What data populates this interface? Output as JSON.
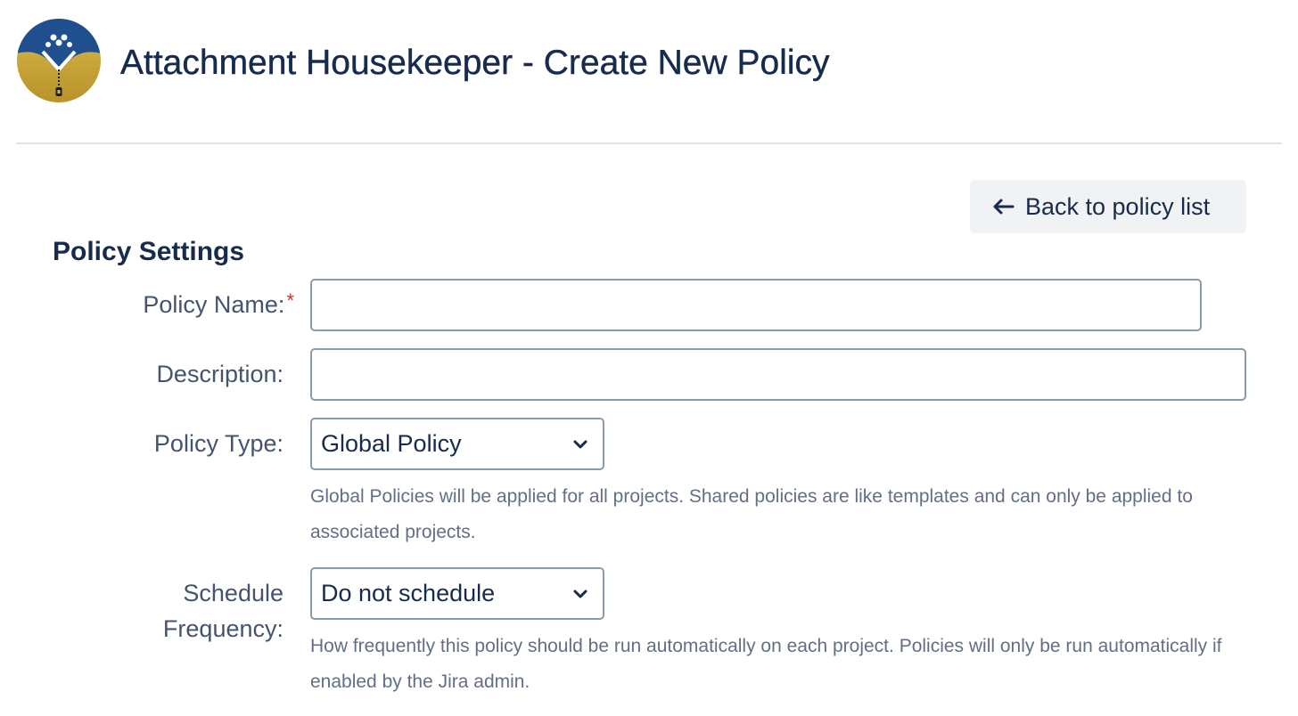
{
  "header": {
    "title": "Attachment Housekeeper - Create New Policy",
    "logo_icon": "attachment-housekeeper-logo"
  },
  "actions": {
    "back_label": "Back to policy list",
    "back_icon": "arrow-left-icon"
  },
  "section": {
    "title": "Policy Settings"
  },
  "form": {
    "policy_name": {
      "label": "Policy Name:",
      "required_marker": "*",
      "value": ""
    },
    "description": {
      "label": "Description:",
      "value": ""
    },
    "policy_type": {
      "label": "Policy Type:",
      "selected": "Global Policy",
      "help": "Global Policies will be applied for all projects. Shared policies are like templates and can only be applied to associated projects."
    },
    "schedule_frequency": {
      "label_line1": "Schedule",
      "label_line2": "Frequency:",
      "selected": "Do not schedule",
      "help": "How frequently this policy should be run automatically on each project. Policies will only be run automatically if enabled by the Jira admin."
    }
  },
  "colors": {
    "title_text": "#172b4d",
    "label_text": "#44546f",
    "help_text": "#626f86",
    "required": "#c9372c",
    "input_border": "#8c9bab",
    "button_bg": "#f1f2f4",
    "logo_blue": "#1f4f8f",
    "logo_gold": "#c9a63a"
  }
}
